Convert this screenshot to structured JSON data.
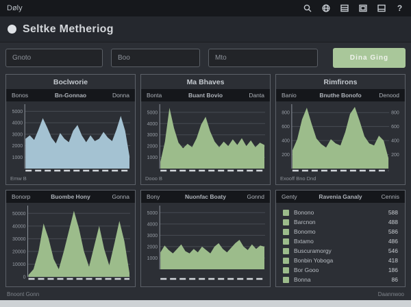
{
  "topbar": {
    "title": "Døly",
    "help_glyph": "?",
    "icons": [
      "search-icon",
      "globe-icon",
      "panel-list-icon",
      "panel-box-icon",
      "panel-split-icon",
      "help-icon"
    ]
  },
  "header": {
    "title": "Seltke Metheriog"
  },
  "filters": {
    "inputs": [
      {
        "placeholder": "Gnoto"
      },
      {
        "placeholder": "Boo"
      },
      {
        "placeholder": "Mto"
      }
    ],
    "submit_label": "Dina Ging"
  },
  "panels": [
    {
      "title": "Boclworie",
      "columns": [
        "Bonos",
        "Bn-Gonnao",
        "Donna"
      ],
      "caption": "Emw B"
    },
    {
      "title": "Ma Bhaves",
      "columns": [
        "Bonta",
        "Buant Bovio",
        "Danta"
      ],
      "caption": "Dooo B"
    },
    {
      "title": "Rimfirons",
      "columns": [
        "Banio",
        "Bnuthe Bonofo",
        "Denood"
      ],
      "caption": "Exooff Bno Dnd"
    },
    {
      "columns": [
        "Bonorp",
        "Buombe Hony",
        "Gonna"
      ]
    },
    {
      "columns": [
        "Bony",
        "Nuonfac Boaty",
        "Gonnd"
      ]
    },
    {
      "columns": [
        "Genty",
        "Ravenia Ganaly",
        "Cennis"
      ]
    }
  ],
  "footer": {
    "left": "Bnoont Gonn",
    "right": "Daannwoo"
  },
  "colors": {
    "page_bg": "#2b2e34",
    "panel_bg": "#2c2f35",
    "strip_bg": "#15171b",
    "accent_blue": "#a4c2d2",
    "accent_green": "#9cbc8b",
    "button_green": "#a9c79a"
  },
  "chart_data": [
    {
      "type": "area",
      "title": "Boclworie",
      "color": "#a4c2d2",
      "yticks": [
        5000,
        4000,
        3000,
        2000,
        1000
      ],
      "ylim": [
        0,
        5500
      ],
      "dash_gap": 3,
      "grid": true,
      "legend_position": "none",
      "values": [
        2600,
        2900,
        2500,
        3400,
        4400,
        3600,
        2700,
        2200,
        3100,
        2600,
        2300,
        3300,
        3800,
        2900,
        2300,
        2900,
        2400,
        2600,
        3200,
        2700,
        2400,
        3400,
        4600,
        3300,
        1100
      ]
    },
    {
      "type": "area",
      "title": "Ma Bhaves",
      "color": "#9cbc8b",
      "yticks": [
        5000,
        4000,
        3000,
        2000,
        1000
      ],
      "ylim": [
        0,
        5600
      ],
      "dash_gap": 3,
      "grid": true,
      "legend_position": "none",
      "values": [
        600,
        2400,
        5400,
        3600,
        2300,
        1800,
        2200,
        1900,
        2700,
        3900,
        4600,
        3300,
        2400,
        1900,
        2400,
        2000,
        2600,
        2100,
        2700,
        2000,
        2500,
        1900,
        2300,
        2100
      ]
    },
    {
      "type": "area",
      "title": "Rimfirons",
      "color": "#9cbc8b",
      "right_labels": true,
      "yticks": [
        800,
        600,
        400,
        200
      ],
      "ylim": [
        0,
        900
      ],
      "dash_gap": 3,
      "grid": true,
      "legend_position": "none",
      "values": [
        260,
        420,
        700,
        870,
        640,
        430,
        350,
        300,
        420,
        360,
        330,
        520,
        780,
        880,
        680,
        460,
        360,
        330,
        470,
        400,
        150
      ]
    },
    {
      "type": "area",
      "title": "Buombe Hony",
      "color": "#9cbc8b",
      "yticks": [
        50000,
        40000,
        30000,
        20000,
        10000,
        0
      ],
      "ylim": [
        0,
        55000
      ],
      "dash_gap": 3,
      "grid": true,
      "legend_position": "none",
      "values": [
        1500,
        6000,
        20000,
        42000,
        30000,
        14000,
        6000,
        20000,
        36000,
        52000,
        38000,
        20000,
        8000,
        24000,
        40000,
        22000,
        9000,
        26000,
        44000,
        28000,
        3000
      ]
    },
    {
      "type": "area",
      "title": "Nuonfac Boaty",
      "color": "#9cbc8b",
      "yticks": [
        5000,
        4000,
        3000,
        2000,
        1000
      ],
      "ylim": [
        0,
        5500
      ],
      "dash_gap": 14,
      "grid": true,
      "legend_position": "none",
      "values": [
        1500,
        2100,
        1700,
        1400,
        1800,
        2200,
        1600,
        1400,
        1800,
        1500,
        2000,
        1700,
        1400,
        2000,
        2300,
        1800,
        1500,
        1900,
        2300,
        2600,
        2000,
        1700,
        2200,
        1800,
        2100,
        2000
      ]
    },
    {
      "type": "table",
      "title": "Ravenia Ganaly",
      "swatch_color": "#9cbc8b",
      "rows": [
        {
          "label": "Bonono",
          "value": "588"
        },
        {
          "label": "Barcnon",
          "value": "488"
        },
        {
          "label": "Bonomo",
          "value": "586"
        },
        {
          "label": "Bxtamo",
          "value": "486"
        },
        {
          "label": "Buscuramorgy",
          "value": "546"
        },
        {
          "label": "Bonbin Yoboga",
          "value": "418"
        },
        {
          "label": "Bor Gooo",
          "value": "186"
        },
        {
          "label": "Bonna",
          "value": "86"
        }
      ]
    }
  ]
}
